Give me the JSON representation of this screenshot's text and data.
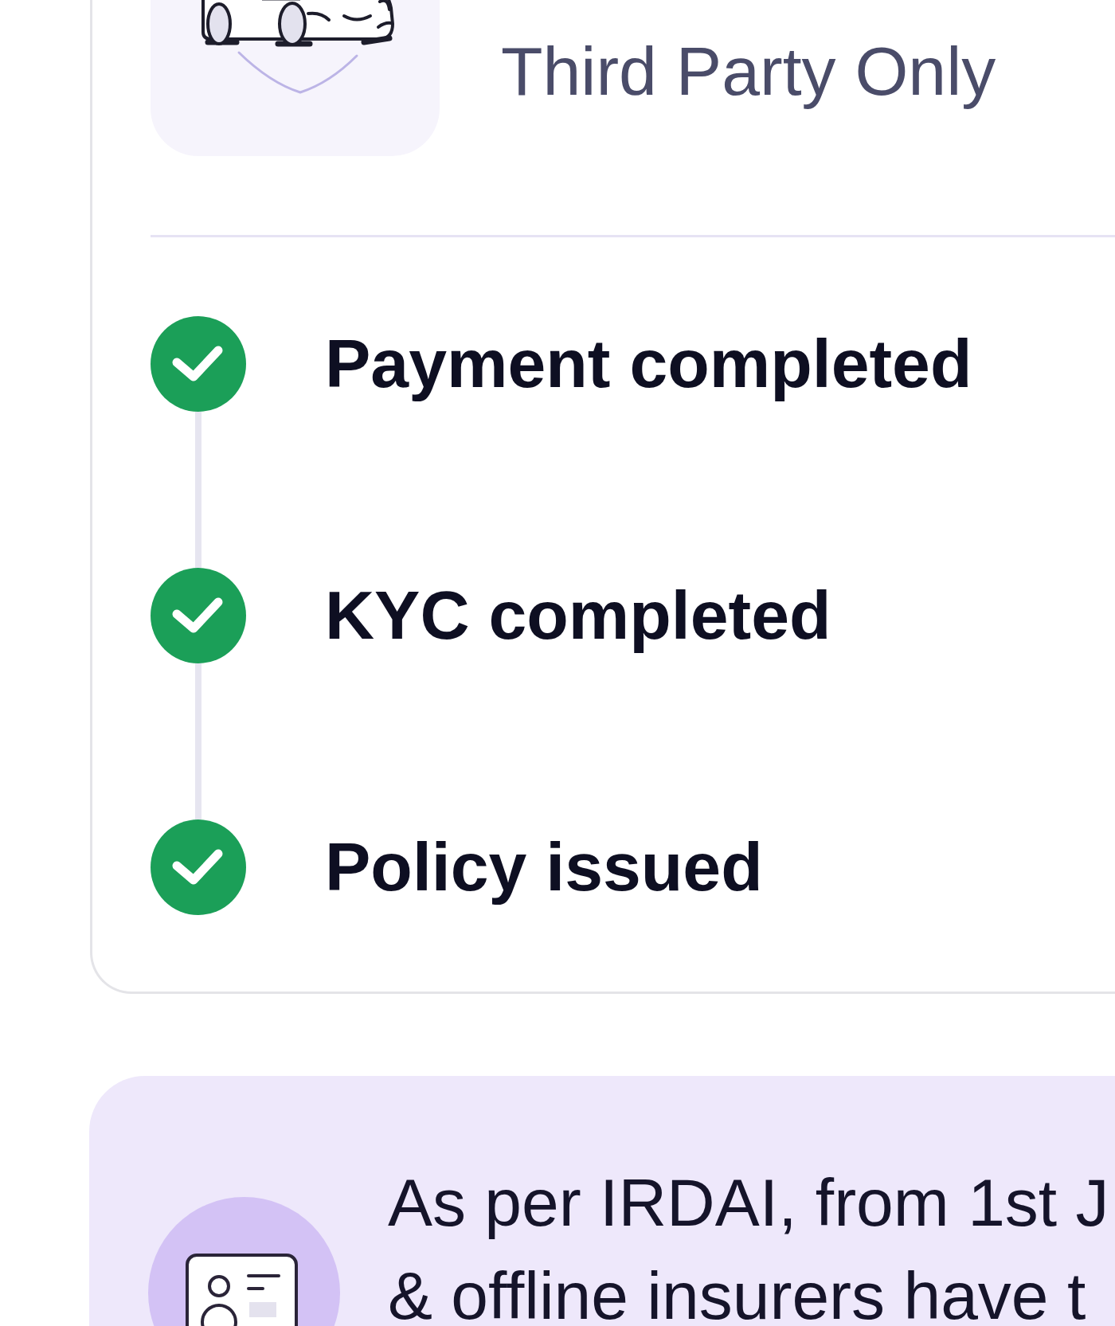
{
  "plan": {
    "name": "Third Party Only"
  },
  "steps": [
    {
      "label": "Payment completed",
      "completed": true
    },
    {
      "label": "KYC completed",
      "completed": true
    },
    {
      "label": "Policy issued",
      "completed": true
    }
  ],
  "notice": {
    "lines": [
      "As per IRDAI, from 1st J",
      "& offline insurers have t"
    ]
  }
}
